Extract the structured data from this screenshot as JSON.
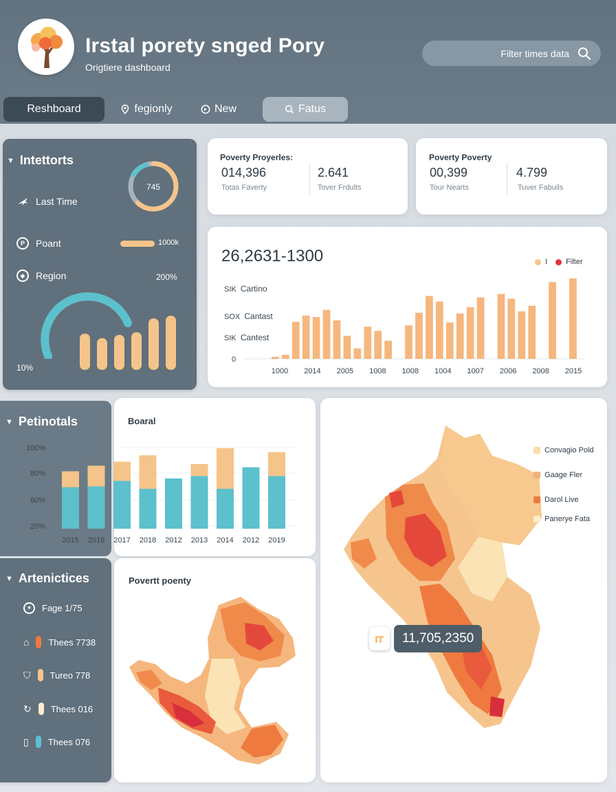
{
  "header": {
    "title": "Irstal porety snged Pory",
    "subtitle": "Origtiere dashboard",
    "search_placeholder": "Filter times data",
    "logo_icon": "tree-icon"
  },
  "nav": {
    "tabs": [
      {
        "label": "Reshboard",
        "icon": null
      },
      {
        "label": "fegionly",
        "icon": "location-pin-icon"
      },
      {
        "label": "New",
        "icon": "circle-arrow-icon"
      },
      {
        "label": "Fatus",
        "icon": "search-icon"
      }
    ]
  },
  "indicators": {
    "title": "Intettorts",
    "gauge_value": "745",
    "gauge_fraction": 0.62,
    "rows": [
      {
        "label": "Last Time",
        "value": "",
        "icon": "airplane-icon"
      },
      {
        "label": "Poant",
        "value": "1000k",
        "icon": "coin-icon"
      },
      {
        "label": "Region",
        "value": "200%",
        "icon": "globe-icon"
      }
    ],
    "bottom_label": "10%",
    "mini_bars": [
      0.55,
      0.48,
      0.53,
      0.57,
      0.78,
      0.82
    ]
  },
  "stat_cards": [
    {
      "title": "Poverty Proyerles:",
      "items": [
        {
          "value": "014,396",
          "label": "Totas Faverty"
        },
        {
          "value": "2.641",
          "label": "Tover Frdults"
        }
      ]
    },
    {
      "title": "Poverty Poverty",
      "items": [
        {
          "value": "00,399",
          "label": "Tour Nearts"
        },
        {
          "value": "4.799",
          "label": "Tuver Fabuils"
        }
      ]
    }
  ],
  "bar_chart": {
    "title": "26,2631-1300",
    "legend": [
      {
        "name": "I",
        "color": "#f5c48a"
      },
      {
        "name": "Filter",
        "color": "#e0353a"
      }
    ],
    "ytick_labels": [
      {
        "value": "SIK",
        "text": "Cartino"
      },
      {
        "value": "SOX",
        "text": "Cantast"
      },
      {
        "value": "SIK",
        "text": "Cantest"
      },
      {
        "value": "0",
        "text": ""
      }
    ],
    "xtick_labels": [
      "1000",
      "2014",
      "2005",
      "1008",
      "1008",
      "1004",
      "1007",
      "2006",
      "2008",
      "2015"
    ]
  },
  "chart_data": [
    {
      "type": "bar",
      "title": "26,2631-1300",
      "ylim": [
        0,
        120
      ],
      "values": [
        3,
        6,
        53,
        62,
        60,
        70,
        55,
        33,
        15,
        46,
        40,
        26,
        0,
        48,
        66,
        90,
        82,
        52,
        65,
        74,
        88,
        0,
        93,
        86,
        68,
        76,
        0,
        110,
        0,
        115
      ],
      "x_tick_labels": [
        "1000",
        "2014",
        "2005",
        "1008",
        "1008",
        "1004",
        "1007",
        "2006",
        "2008",
        "2015"
      ]
    },
    {
      "type": "bar",
      "title": "Boaral",
      "stacked": true,
      "categories": [
        "2015",
        "2016",
        "2017",
        "2018",
        "2012",
        "2013",
        "2014",
        "2012",
        "2019"
      ],
      "ylim": [
        0,
        100
      ],
      "y_tick_labels": [
        "100%",
        "80%",
        "60%",
        "20%"
      ],
      "series": [
        {
          "color": "#5dc0cd",
          "values": [
            52,
            53,
            60,
            50,
            63,
            66,
            50,
            77,
            66
          ]
        },
        {
          "color": "#f5c48a",
          "values": [
            20,
            26,
            24,
            42,
            0,
            15,
            51,
            0,
            30
          ]
        }
      ]
    }
  ],
  "stacked_panel": {
    "side_title": "Petinotals",
    "chart_title": "Boaral",
    "y_labels": [
      "100%",
      "80%",
      "60%",
      "20%"
    ],
    "x_labels": [
      "2015",
      "2016",
      "2017",
      "2018",
      "2012",
      "2013",
      "2014",
      "2012",
      "2019"
    ]
  },
  "map_small": {
    "title": "Povertt poenty"
  },
  "map_large": {
    "legend": [
      {
        "name": "Convagio Pold",
        "color": "#f9dca8"
      },
      {
        "name": "Gaage Fler",
        "color": "#f2b27a"
      },
      {
        "name": "Darol Live",
        "color": "#ee7a3f"
      },
      {
        "name": "Panerye Fata",
        "color": "#fbeccb"
      }
    ],
    "tooltip_value": "11,705,2350"
  },
  "attributes": {
    "title": "Artenictices",
    "items": [
      {
        "label": "Fage 1/75",
        "icon": "badge-icon",
        "color": "#ffffff"
      },
      {
        "label": "Thees 7738",
        "icon": "bucket-icon",
        "color": "#ee7a3f"
      },
      {
        "label": "Tureo 778",
        "icon": "shield-icon",
        "color": "#f5c48a"
      },
      {
        "label": "Thees 016",
        "icon": "refresh-icon",
        "color": "#fbeccb"
      },
      {
        "label": "Thees 076",
        "icon": "jar-icon",
        "color": "#5dc0cd"
      }
    ]
  }
}
